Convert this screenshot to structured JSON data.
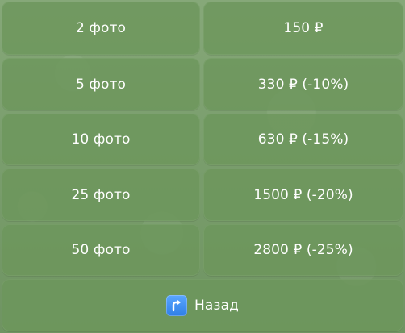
{
  "keyboard": {
    "rows": [
      {
        "count": "2 фото",
        "price": "150 ₽"
      },
      {
        "count": "5 фото",
        "price": "330 ₽ (-10%)"
      },
      {
        "count": "10 фото",
        "price": "630 ₽ (-15%)"
      },
      {
        "count": "25 фото",
        "price": "1500 ₽ (-20%)"
      },
      {
        "count": "50 фото",
        "price": "2800 ₽ (-25%)"
      }
    ],
    "back_label": "Назад",
    "back_icon": "arrow-up-right-icon"
  },
  "colors": {
    "background": "#7a9e6d",
    "button": "#6c965c",
    "text": "#ffffff",
    "back_icon": "#2f7fe6"
  }
}
